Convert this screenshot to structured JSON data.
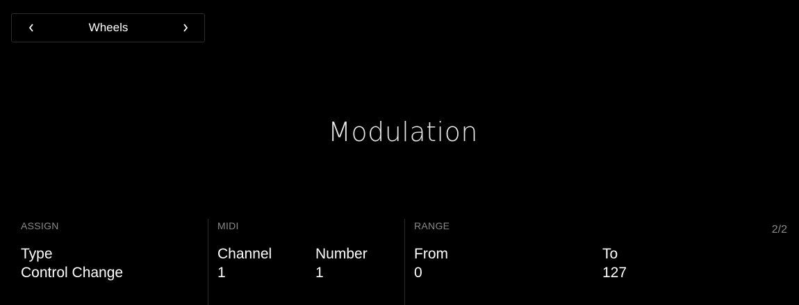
{
  "nav": {
    "title": "Wheels",
    "prev_icon": "chevron-left-icon",
    "next_icon": "chevron-right-icon"
  },
  "main": {
    "title": "Modulation"
  },
  "sections": {
    "assign": {
      "header": "ASSIGN",
      "params": [
        {
          "label": "Type",
          "value": "Control Change"
        }
      ]
    },
    "midi": {
      "header": "MIDI",
      "params": [
        {
          "label": "Channel",
          "value": "1"
        },
        {
          "label": "Number",
          "value": "1"
        }
      ]
    },
    "range": {
      "header": "RANGE",
      "params": [
        {
          "label": "From",
          "value": "0"
        },
        {
          "label": "To",
          "value": "127"
        }
      ]
    }
  },
  "page_indicator": "2/2",
  "colors": {
    "background": "#000000",
    "text": "#ffffff",
    "header_text": "#8a8a8a",
    "divider": "#2c2c2c"
  }
}
